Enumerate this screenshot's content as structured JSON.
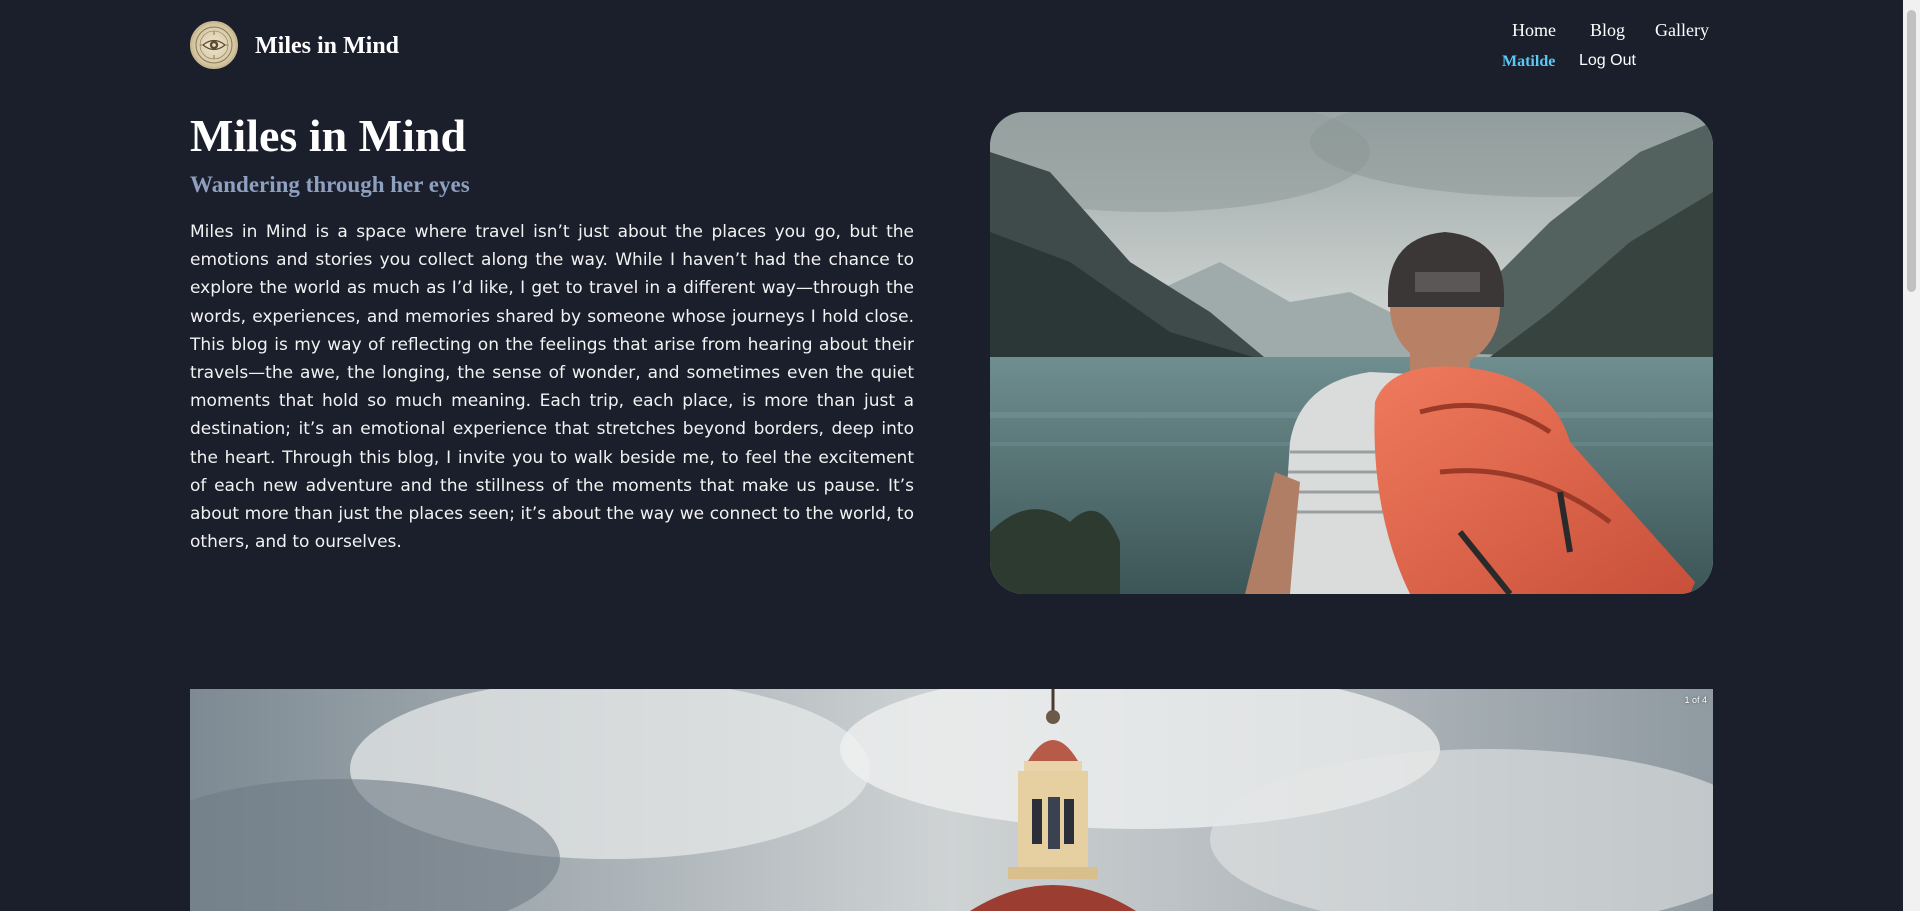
{
  "header": {
    "site_title": "Miles in Mind",
    "logo_icon": "eye-emblem-icon",
    "nav": {
      "home": "Home",
      "blog": "Blog",
      "gallery": "Gallery",
      "user": "Matilde",
      "logout": "Log Out"
    }
  },
  "hero": {
    "title": "Miles in Mind",
    "subtitle": "Wandering through her eyes",
    "body": "Miles in Mind is a space where travel isn’t just about the places you go, but the emotions and stories you collect along the way. While I haven’t had the chance to explore the world as much as I’d like, I get to travel in a different way—through the words, experiences, and memories shared by someone whose journeys I hold close. This blog is my way of reflecting on the feelings that arise from hearing about their travels—the awe, the longing, the sense of wonder, and sometimes even the quiet moments that hold so much meaning. Each trip, each place, is more than just a destination; it’s an emotional experience that stretches beyond borders, deep into the heart. Through this blog, I invite you to walk beside me, to feel the excitement of each new adventure and the stillness of the moments that make us pause. It’s about more than just the places seen; it’s about the way we connect to the world, to others, and to ourselves.",
    "image": "hiker-with-orange-backpack-at-mountain-lake"
  },
  "carousel": {
    "counter": "1 of 4",
    "image": "church-dome-under-cloudy-sky"
  },
  "colors": {
    "background": "#1a1f2b",
    "accent_user": "#5bc8f5",
    "subtitle": "#8f9fc0"
  }
}
